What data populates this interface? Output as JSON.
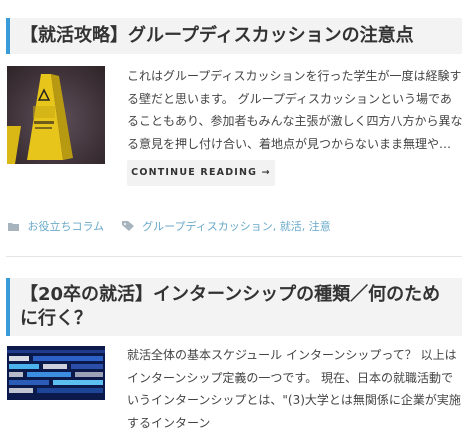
{
  "posts": [
    {
      "title": "【就活攻略】グループディスカッションの注意点",
      "excerpt": "これはグループディスカッションを行った学生が一度は経験する壁だと思います。 グループディスカッションという場であることもあり、参加者もみんな主張が激しく四方八方から異なる意見を押し付け合い、着地点が見つからないまま無理や…",
      "read_more": "CONTINUE READING →",
      "category": "お役立ちコラム",
      "tags": "グループディスカッション, 就活, 注意",
      "thumb_sign_text": "CAUTION"
    },
    {
      "title": "【20卒の就活】インターンシップの種類／何のために行く？",
      "excerpt": "就活全体の基本スケジュール インターンシップって？ 以上はインターンシップ定義の一つです。 現在、日本の就職活動でいうインターンシップとは、\"(3)大学とは無関係に企業が実施するインターン"
    }
  ],
  "colors": {
    "accent": "#3a9bd9",
    "meta_link": "#6aa9c9"
  },
  "icons": {
    "category": "folder-icon",
    "tag": "tag-icon"
  }
}
